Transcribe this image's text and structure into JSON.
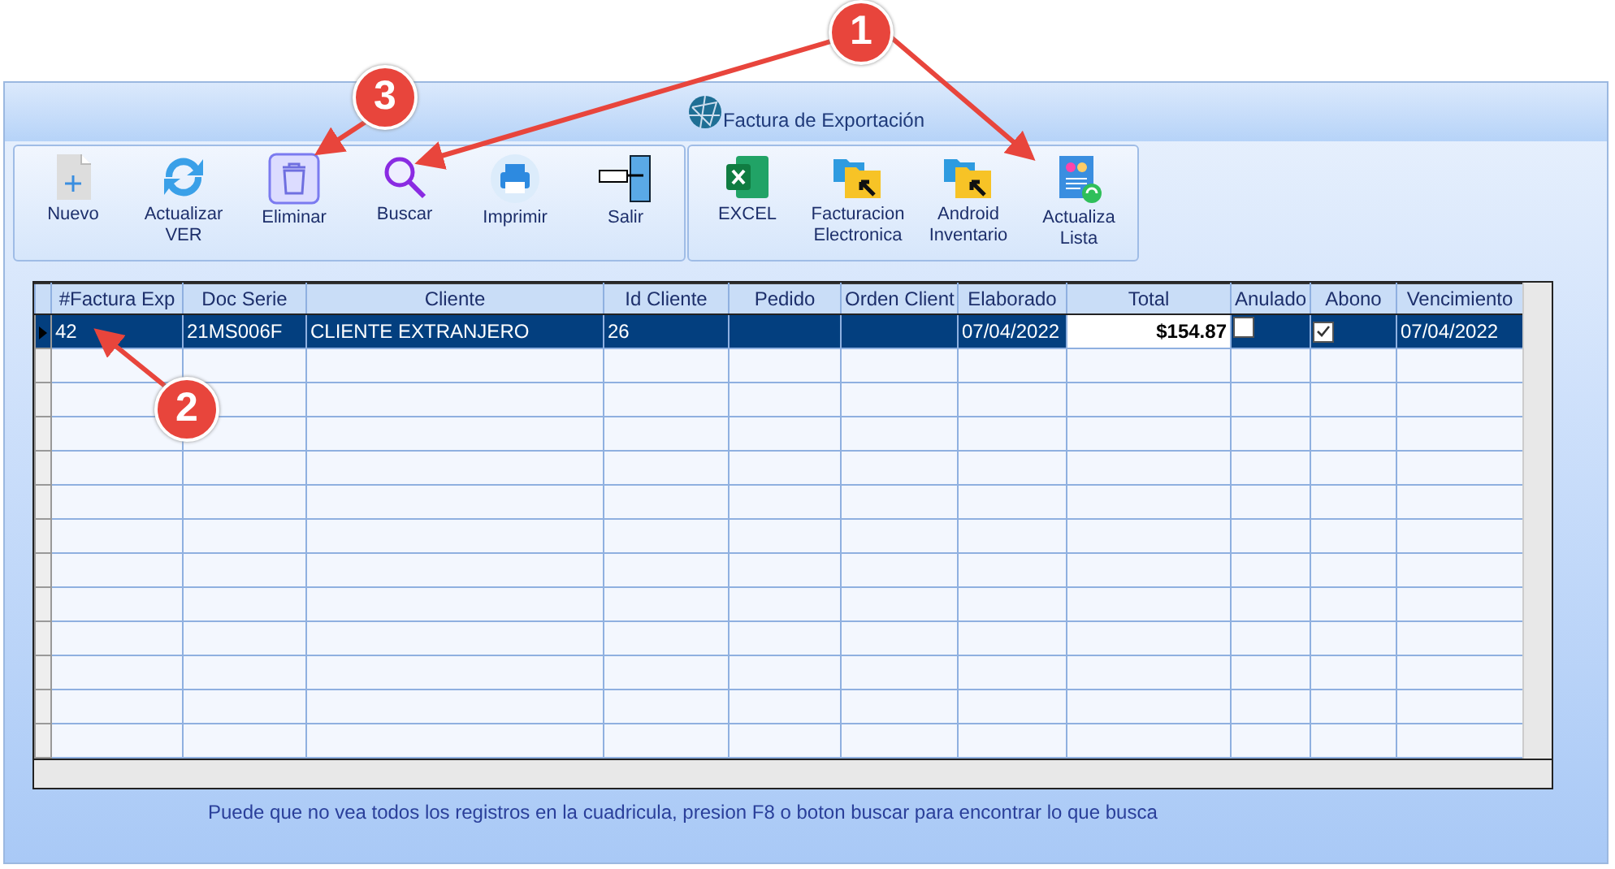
{
  "window": {
    "title": "Factura de Exportación"
  },
  "toolbar_groups": [
    {
      "buttons": [
        {
          "kind": "new",
          "label": "Nuevo"
        },
        {
          "kind": "refresh",
          "label": "Actualizar VER"
        },
        {
          "kind": "delete",
          "label": "Eliminar"
        },
        {
          "kind": "search",
          "label": "Buscar"
        },
        {
          "kind": "print",
          "label": "Imprimir"
        },
        {
          "kind": "exit",
          "label": "Salir"
        }
      ]
    },
    {
      "buttons": [
        {
          "kind": "excel",
          "label": "EXCEL"
        },
        {
          "kind": "folder",
          "label": "Facturacion Electronica"
        },
        {
          "kind": "folder",
          "label": "Android Inventario"
        },
        {
          "kind": "list",
          "label": "Actualiza Lista"
        }
      ]
    }
  ],
  "table": {
    "columns": [
      "#Factura Exp",
      "Doc Serie",
      "Cliente",
      "Id Cliente",
      "Pedido",
      "Orden Client",
      "Elaborado",
      "Total",
      "Anulado",
      "Abono",
      "Vencimiento"
    ],
    "rows": [
      {
        "selected": true,
        "cells": [
          "42",
          "21MS006F",
          "CLIENTE EXTRANJERO",
          "26",
          "",
          "",
          "07/04/2022",
          "$154.87"
        ],
        "anulado": false,
        "abono": true,
        "vencimiento": "07/04/2022"
      }
    ]
  },
  "status_bar": "Puede que no vea todos los registros en la cuadricula, presion F8 o boton buscar para encontrar lo que busca",
  "callouts": [
    {
      "number": "1"
    },
    {
      "number": "2"
    },
    {
      "number": "3"
    }
  ]
}
